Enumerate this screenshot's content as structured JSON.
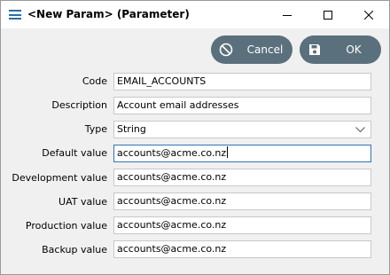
{
  "window": {
    "title": "<New Param> (Parameter)",
    "controls": {
      "minimize": "minimize-icon",
      "maximize": "maximize-icon",
      "close": "close-icon"
    }
  },
  "toolbar": {
    "cancel_label": "Cancel",
    "cancel_icon": "cancel-icon",
    "ok_label": "OK",
    "ok_icon": "save-icon",
    "button_color": "#5b707d"
  },
  "form": {
    "code": {
      "label": "Code",
      "value": "EMAIL_ACCOUNTS"
    },
    "description": {
      "label": "Description",
      "value": "Account email addresses"
    },
    "type": {
      "label": "Type",
      "value": "String"
    },
    "default_value": {
      "label": "Default value",
      "value": "accounts@acme.co.nz"
    },
    "development_value": {
      "label": "Development value",
      "value": "accounts@acme.co.nz"
    },
    "uat_value": {
      "label": "UAT value",
      "value": "accounts@acme.co.nz"
    },
    "production_value": {
      "label": "Production value",
      "value": "accounts@acme.co.nz"
    },
    "backup_value": {
      "label": "Backup value",
      "value": "accounts@acme.co.nz"
    }
  },
  "colors": {
    "focus_border": "#2e75b6",
    "field_border": "#c8c8c8",
    "dialog_bg": "#f0f0f0"
  }
}
